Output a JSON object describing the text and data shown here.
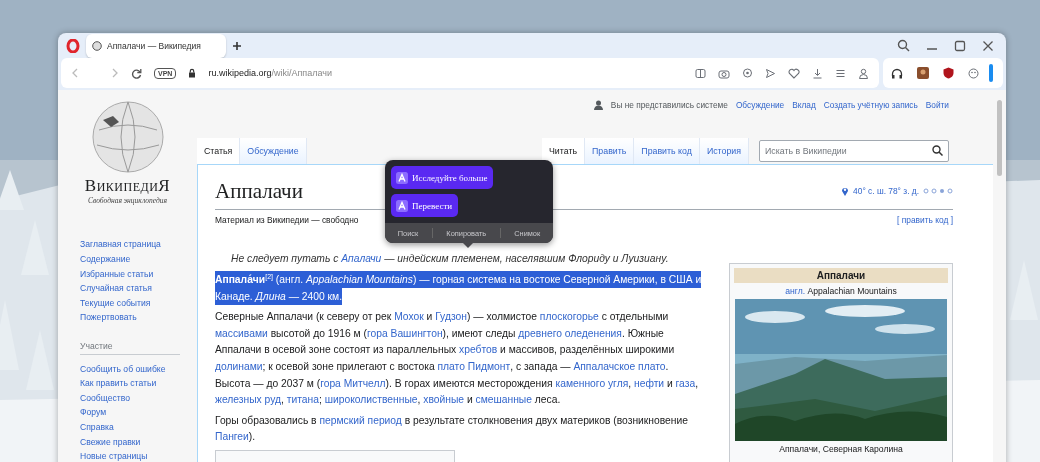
{
  "browser": {
    "tabs": [
      {
        "title": "Аппалачи — Википедия",
        "selected": true
      }
    ],
    "vpn": "VPN",
    "url": {
      "domain": "ru.wikipedia.org",
      "path": "/wiki/Аппалачи"
    }
  },
  "wiki": {
    "logo": {
      "wordmark": "ВикипедиЯ",
      "tagline": "Свободная энциклопедия"
    },
    "nav_links": [
      "Заглавная страница",
      "Содержание",
      "Избранные статьи",
      "Случайная статья",
      "Текущие события",
      "Пожертвовать"
    ],
    "participation": {
      "heading": "Участие",
      "links": [
        "Сообщить об ошибке",
        "Как править статьи",
        "Сообщество",
        "Форум",
        "Справка",
        "Свежие правки",
        "Новые страницы"
      ]
    },
    "user_bar": {
      "status": "Вы не представились системе",
      "links": [
        "Обсуждение",
        "Вклад",
        "Создать учётную запись",
        "Войти"
      ]
    },
    "page_tabs": [
      {
        "label": "Статья",
        "selected": true
      },
      {
        "label": "Обсуждение",
        "selected": false
      }
    ],
    "view_tabs": [
      {
        "label": "Читать",
        "selected": true
      },
      {
        "label": "Править",
        "selected": false
      },
      {
        "label": "Править код",
        "selected": false
      },
      {
        "label": "История",
        "selected": false
      }
    ],
    "search": {
      "placeholder": "Искать в Википедии"
    },
    "article": {
      "title": "Аппалачи",
      "coordinates": "40° с. ш. 78° з. д.",
      "subtitle": "Материал из Википедии — свободно",
      "edit_link": "[ править код ]",
      "hatnote": [
        {
          "text": "Не следует путать с ",
          "kind": "text"
        },
        {
          "text": "Апалачи",
          "kind": "link"
        },
        {
          "text": " — индейским племенем, населявшим Флориду и Луизиану.",
          "kind": "text"
        }
      ],
      "paragraphs": [
        {
          "kind": "selection",
          "segments": [
            {
              "text": "**Аппала́чи**$^{[2]}$ (англ. *Appalachian Mountains*) — горная система на востоке Северной Америки, в США и Канаде. *Длина* — 2400 км.",
              "kind": "text"
            }
          ]
        },
        {
          "kind": "plain",
          "segments": [
            {
              "text": "Северные Аппалачи (к северу от рек ",
              "kind": "text"
            },
            {
              "text": "Мохок",
              "kind": "link"
            },
            {
              "text": " и ",
              "kind": "text"
            },
            {
              "text": "Гудзон",
              "kind": "link"
            },
            {
              "text": ") — холмистое ",
              "kind": "text"
            },
            {
              "text": "плоскогорье",
              "kind": "link"
            },
            {
              "text": " с отдельными ",
              "kind": "text"
            },
            {
              "text": "массивами",
              "kind": "link"
            },
            {
              "text": " высотой до 1916 м (",
              "kind": "text"
            },
            {
              "text": "гора Вашингтон",
              "kind": "link"
            },
            {
              "text": "), имеют следы ",
              "kind": "text"
            },
            {
              "text": "древнего оледенения",
              "kind": "link"
            },
            {
              "text": ". Южные Аппалачи в осевой зоне состоят из параллельных ",
              "kind": "text"
            },
            {
              "text": "хребтов",
              "kind": "link"
            },
            {
              "text": " и массивов, разделённых широкими ",
              "kind": "text"
            },
            {
              "text": "долинами",
              "kind": "link"
            },
            {
              "text": "; к осевой зоне прилегают с востока ",
              "kind": "text"
            },
            {
              "text": "плато Пидмонт",
              "kind": "link"
            },
            {
              "text": ", с запада — ",
              "kind": "text"
            },
            {
              "text": "Аппалачское плато",
              "kind": "link"
            },
            {
              "text": ". Высота — до 2037 м (",
              "kind": "text"
            },
            {
              "text": "гора Митчелл",
              "kind": "link"
            },
            {
              "text": "). В горах имеются месторождения ",
              "kind": "text"
            },
            {
              "text": "каменного угля",
              "kind": "link"
            },
            {
              "text": ", ",
              "kind": "text"
            },
            {
              "text": "нефти",
              "kind": "link"
            },
            {
              "text": " и ",
              "kind": "text"
            },
            {
              "text": "газа",
              "kind": "link"
            },
            {
              "text": ", ",
              "kind": "text"
            },
            {
              "text": "железных руд",
              "kind": "link"
            },
            {
              "text": ", ",
              "kind": "text"
            },
            {
              "text": "титана",
              "kind": "link"
            },
            {
              "text": "; ",
              "kind": "text"
            },
            {
              "text": "широколиственные",
              "kind": "link"
            },
            {
              "text": ", ",
              "kind": "text"
            },
            {
              "text": "хвойные",
              "kind": "link"
            },
            {
              "text": " и ",
              "kind": "text"
            },
            {
              "text": "смешанные",
              "kind": "link"
            },
            {
              "text": " леса.",
              "kind": "text"
            }
          ]
        },
        {
          "kind": "plain",
          "segments": [
            {
              "text": "Горы образовались в ",
              "kind": "text"
            },
            {
              "text": "пермский период",
              "kind": "link"
            },
            {
              "text": " в результате столкновения двух материков (возникновение ",
              "kind": "text"
            },
            {
              "text": "Пангеи",
              "kind": "link"
            },
            {
              "text": ").",
              "kind": "text"
            }
          ]
        }
      ],
      "infobox": {
        "title": "Аппалачи",
        "lang_link": "англ.",
        "native_name": "Appalachian Mountains",
        "caption": "Аппалачи, Северная Каролина"
      }
    }
  },
  "popup": {
    "actions": [
      "Исследуйте больше",
      "Перевести"
    ],
    "menu": [
      "Поиск",
      "Копировать",
      "Снимок"
    ]
  }
}
